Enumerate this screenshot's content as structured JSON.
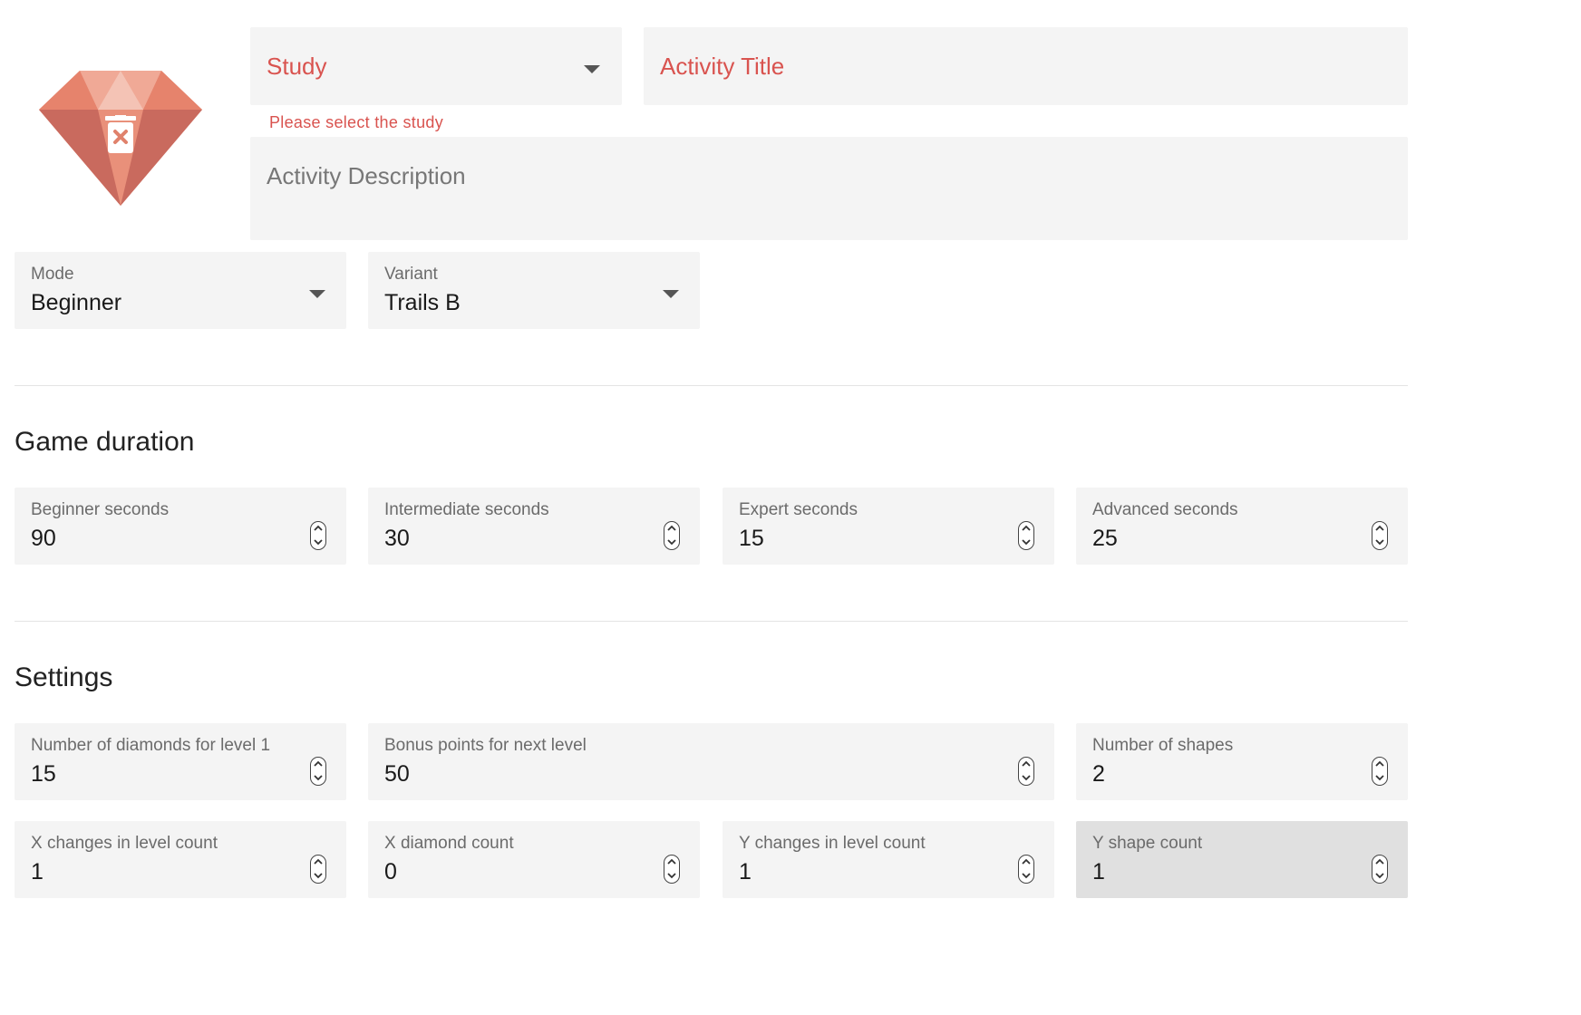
{
  "header": {
    "study_label": "Study",
    "study_error": "Please select the study",
    "title_placeholder": "Activity Title",
    "description_placeholder": "Activity Description"
  },
  "selects": {
    "mode": {
      "label": "Mode",
      "value": "Beginner"
    },
    "variant": {
      "label": "Variant",
      "value": "Trails B"
    }
  },
  "game_duration": {
    "title": "Game duration",
    "fields": [
      {
        "label": "Beginner seconds",
        "value": "90"
      },
      {
        "label": "Intermediate seconds",
        "value": "30"
      },
      {
        "label": "Expert seconds",
        "value": "15"
      },
      {
        "label": "Advanced seconds",
        "value": "25"
      }
    ]
  },
  "settings": {
    "title": "Settings",
    "fields": [
      {
        "label": "Number of diamonds for level 1",
        "value": "15"
      },
      {
        "label": "Bonus points for next level",
        "value": "50"
      },
      {
        "label": "Number of shapes",
        "value": "2"
      },
      {
        "label": "X changes in level count",
        "value": "1"
      },
      {
        "label": "X diamond count",
        "value": "0"
      },
      {
        "label": "Y changes in level count",
        "value": "1"
      },
      {
        "label": "Y shape count",
        "value": "1"
      }
    ]
  },
  "colors": {
    "error": "#d9534f",
    "field_bg": "#f4f4f4",
    "disabled_bg": "#e0e0e0",
    "gem_primary": "#e9907a",
    "gem_dark": "#c96a5e"
  },
  "icons": {
    "activity_icon": "diamond-gem-icon",
    "delete_icon": "trash-icon"
  }
}
